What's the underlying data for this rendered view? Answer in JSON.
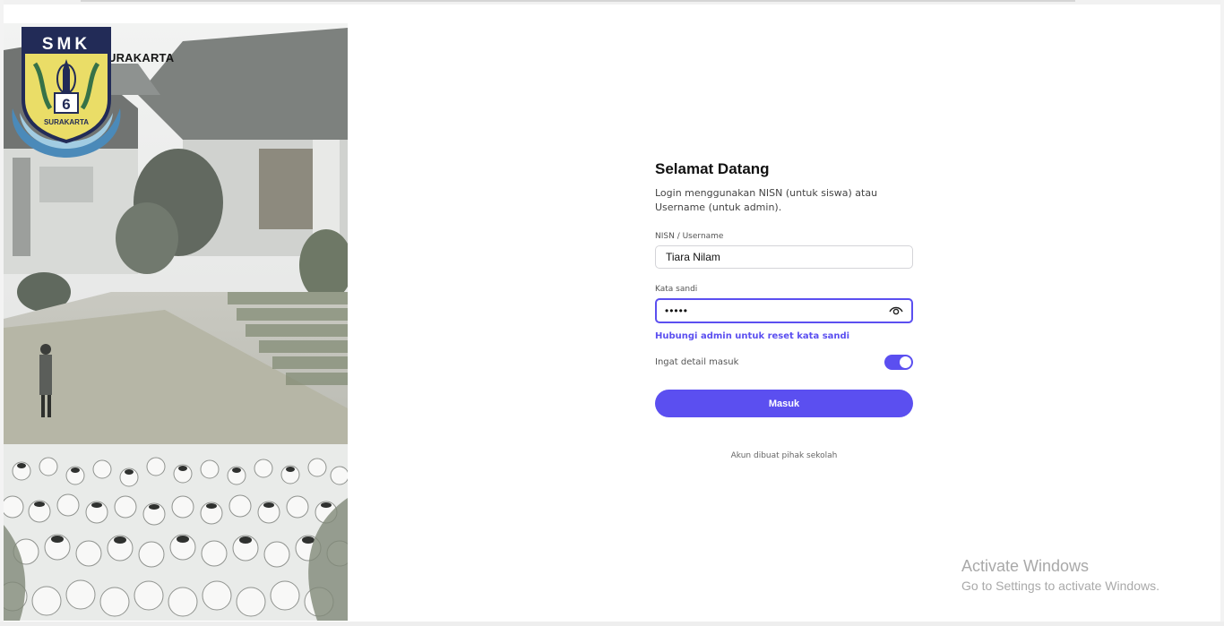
{
  "brand": {
    "name": "SMKN 6 SURAKARTA",
    "icon": "dots-logo-icon",
    "accent": "#f7d52b"
  },
  "emblem": {
    "top_text": "SMK",
    "number": "6",
    "bottom_text": "SURAKARTA"
  },
  "login": {
    "title": "Selamat Datang",
    "subtitle": "Login menggunakan NISN (untuk siswa) atau Username (untuk admin).",
    "username_label": "NISN / Username",
    "username_value": "Tiara Nilam",
    "password_label": "Kata sandi",
    "password_value": "•••••",
    "password_icon": "eye-icon",
    "reset_link": "Hubungi admin untuk reset kata sandi",
    "remember_label": "Ingat detail masuk",
    "remember_on": true,
    "submit_label": "Masuk",
    "footnote": "Akun dibuat pihak sekolah"
  },
  "colors": {
    "primary": "#5b4ff0",
    "text": "#111111",
    "muted": "#555555"
  },
  "watermark": {
    "title": "Activate Windows",
    "subtitle": "Go to Settings to activate Windows."
  }
}
